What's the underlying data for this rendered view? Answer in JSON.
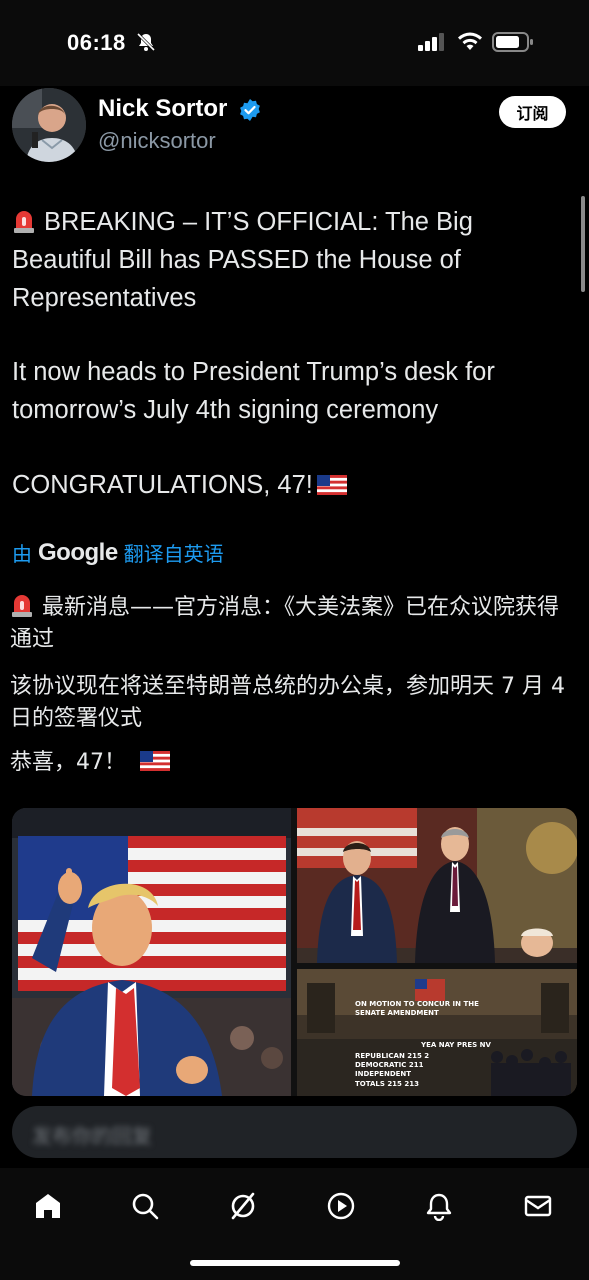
{
  "status": {
    "time": "06:18"
  },
  "author": {
    "name": "Nick Sortor",
    "handle": "@nicksortor",
    "subscribe_label": "订阅"
  },
  "tweet": {
    "p1": "BREAKING – IT’S OFFICIAL: The Big Beautiful Bill has PASSED the House of Representatives",
    "p2": "It now heads to President Trump’s desk for tomorrow’s July 4th signing ceremony",
    "p3": "CONGRATULATIONS, 47!"
  },
  "translation": {
    "prefix": "由",
    "brand": "Google",
    "suffix": "翻译自英语"
  },
  "translated": {
    "z1": "最新消息——官方消息：《大美法案》已在众议院获得通过",
    "z2": "该协议现在将送至特朗普总统的办公桌，参加明天 7 月 4 日的签署仪式",
    "z3": "恭喜，47！"
  },
  "media": {
    "overlay_lines": [
      "ON MOTION TO CONCUR IN THE",
      "SENATE AMENDMENT",
      "YEA  NAY  PRES  NV",
      "REPUBLICAN   215   2",
      "DEMOCRATIC   211",
      "INDEPENDENT",
      "TOTALS   215  213"
    ]
  },
  "reply": {
    "placeholder": "发布你的回复"
  },
  "tabs": [
    "home",
    "search",
    "grok",
    "video",
    "notifications",
    "messages"
  ],
  "colors": {
    "accent": "#1d9bf0",
    "background": "#000000"
  }
}
